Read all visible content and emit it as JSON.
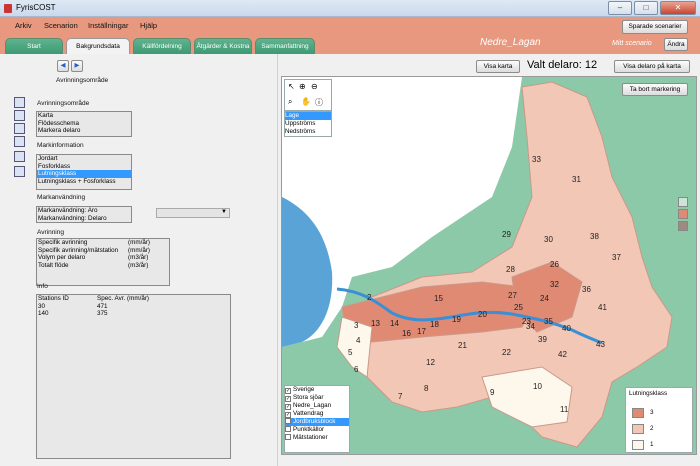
{
  "window": {
    "title": "FyrisCOST",
    "min": "–",
    "max": "□",
    "close": "✕"
  },
  "menu": [
    "Arkiv",
    "Scenarion",
    "Inställningar",
    "Hjälp"
  ],
  "header": {
    "saved_scenarios": "Sparade scenarier",
    "area_name": "Nedre_Lagan",
    "scenario_label": "Mitt scenario",
    "change_btn": "Ändra"
  },
  "tabs": [
    "Start",
    "Bakgrundsdata",
    "Källfördelning",
    "Åtgärder & Kostna",
    "Sammanfattning"
  ],
  "active_tab": 1,
  "left": {
    "section_title": "Avrinningsområde",
    "nav_prev": "◀",
    "nav_next": "▶",
    "avr_label": "Avrinningsområde",
    "avr_items": [
      "Karta",
      "Flödesschema",
      "Markera delaro"
    ],
    "mark_label": "Markinformation",
    "mark_items": [
      "Jordart",
      "Fosforklass",
      "Lutningsklass",
      "Lutningsklass + Fosforklass"
    ],
    "mark_selected": 2,
    "markanv_label": "Markanvändning",
    "markanv_items": [
      "Markanvändning: Aro",
      "Markanvändning: Delaro"
    ],
    "avrinning_label": "Avrinning",
    "avrinning_rows": [
      {
        "name": "Specifik avrinning",
        "unit": "(mm/år)"
      },
      {
        "name": "Specifik avrinning/mätstation",
        "unit": "(mm/år)"
      },
      {
        "name": "Volym per delaro",
        "unit": "(m3/år)"
      },
      {
        "name": "Totalt flöde",
        "unit": "(m3/år)"
      }
    ],
    "info_label": "Info",
    "info_headers": [
      "Stations ID",
      "Spec. Avr. (mm/år)"
    ],
    "info_rows": [
      [
        "30",
        "471"
      ],
      [
        "140",
        "375"
      ]
    ]
  },
  "map_header": {
    "show_map": "Visa karta",
    "selected_text": "Valt delaro: 12",
    "show_delaro": "Visa delaro på karta",
    "remove_mark": "Ta bort markering"
  },
  "map": {
    "modes": [
      "Lage",
      "Uppströms",
      "Nedströms"
    ],
    "mode_selected": 0,
    "layers": [
      {
        "label": "Sverige",
        "checked": true
      },
      {
        "label": "Stora sjöar",
        "checked": true
      },
      {
        "label": "Nedre_Lagan",
        "checked": true
      },
      {
        "label": "Vattendrag",
        "checked": true
      },
      {
        "label": "Jordbruksblock",
        "checked": false,
        "selected": true
      },
      {
        "label": "Punktkällor",
        "checked": false
      },
      {
        "label": "Mätstationer",
        "checked": false
      }
    ],
    "legend_title": "Lutningsklass",
    "legend": [
      {
        "label": "3",
        "color": "#e08a73"
      },
      {
        "label": "2",
        "color": "#f3c7b5"
      },
      {
        "label": "1",
        "color": "#fdf7ec"
      }
    ],
    "swatch_colors": [
      "#c9e6d8",
      "#e08a73",
      "#9b8b80"
    ],
    "subbasin_labels": [
      "33",
      "31",
      "29",
      "30",
      "38",
      "37",
      "26",
      "28",
      "36",
      "27",
      "24",
      "41",
      "2",
      "15",
      "25",
      "18",
      "19",
      "20",
      "23",
      "35",
      "3",
      "13",
      "14",
      "16",
      "17",
      "40",
      "21",
      "39",
      "43",
      "4",
      "22",
      "42",
      "5",
      "12",
      "6",
      "8",
      "9",
      "10",
      "7",
      "11",
      "32",
      "34"
    ]
  }
}
